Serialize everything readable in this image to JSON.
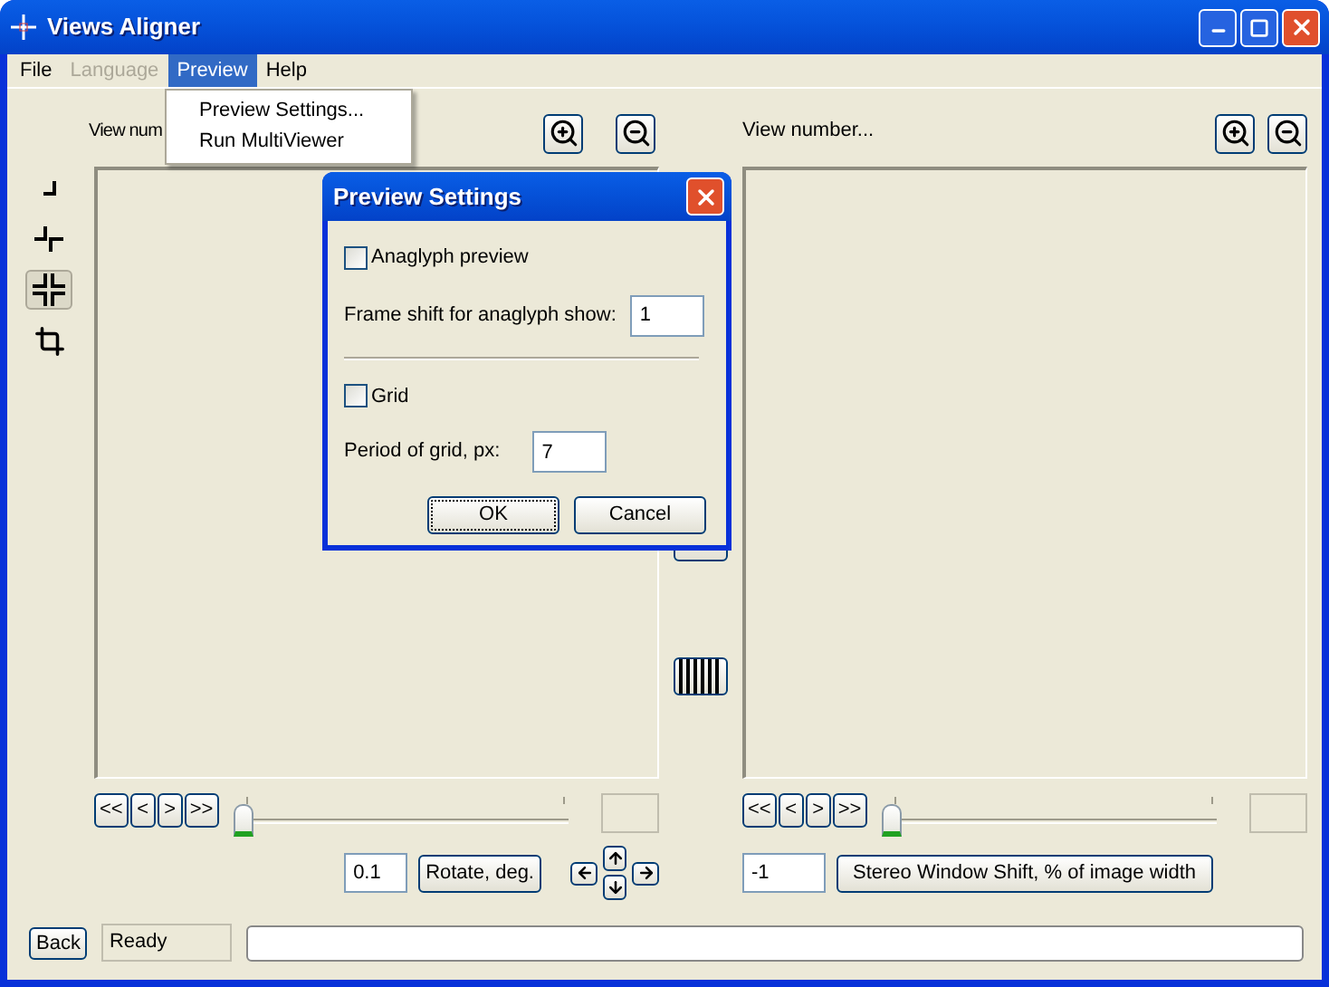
{
  "window": {
    "title": "Views Aligner"
  },
  "menu": [
    {
      "label": "File",
      "disabled": false,
      "selected": false
    },
    {
      "label": "Language",
      "disabled": true,
      "selected": false
    },
    {
      "label": "Preview",
      "disabled": false,
      "selected": true
    },
    {
      "label": "Help",
      "disabled": false,
      "selected": false
    }
  ],
  "open_menu": {
    "items": [
      "Preview Settings...",
      "Run MultiViewer"
    ]
  },
  "tools": [
    {
      "kind": "corner",
      "selected": false
    },
    {
      "kind": "corners",
      "selected": false
    },
    {
      "kind": "cross",
      "selected": true
    },
    {
      "kind": "crop",
      "selected": false
    }
  ],
  "left_view": {
    "label": "View num",
    "nav": [
      "<<",
      "<",
      ">",
      ">>"
    ],
    "slider": {
      "level": 0
    }
  },
  "right_view": {
    "label": "View number...",
    "nav": [
      "<<",
      "<",
      ">",
      ">>"
    ],
    "slider": {
      "level": 0
    }
  },
  "rotate": {
    "value": "0.1",
    "button": "Rotate, deg."
  },
  "stereo_shift": {
    "value": "-1",
    "button": "Stereo Window Shift, % of image width"
  },
  "status_bar": {
    "back": "Back",
    "status": "Ready"
  },
  "dialog": {
    "title": "Preview Settings",
    "anaglyph": {
      "label": "Anaglyph preview",
      "checked": false
    },
    "frame_shift": {
      "label": "Frame shift for anaglyph show:",
      "value": "1"
    },
    "grid": {
      "label": "Grid",
      "checked": false
    },
    "period": {
      "label": "Period of grid, px:",
      "value": "7"
    },
    "buttons": [
      "OK",
      "Cancel"
    ]
  }
}
